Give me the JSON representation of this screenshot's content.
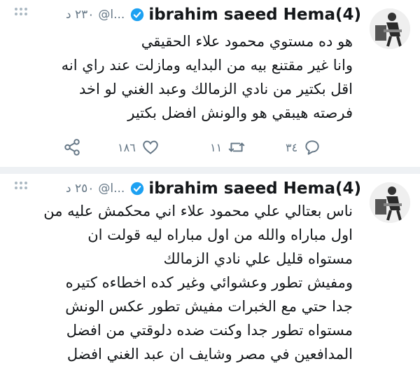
{
  "tweets": [
    {
      "user_name": "ibrahim saeed Hema(4)",
      "handle": "@ا...",
      "time": "٢٣٠ د",
      "lines": [
        "هو ده مستوي محمود علاء الحقيقي",
        "وانا غير مقتنع بيه من البدايه ومازلت عند راي انه",
        "اقل بكتير من نادي الزمالك وعبد الغني لو اخد",
        "فرصته هيبقي هو والونش افضل بكتير"
      ],
      "actions": {
        "replies": "٣٤",
        "retweets": "١١",
        "likes": "١٨٦"
      }
    },
    {
      "user_name": "ibrahim saeed Hema(4)",
      "handle": "@ا...",
      "time": "٢٥٠ د",
      "lines": [
        "ناس بعتالي علي محمود علاء اني محكمش عليه من",
        "اول مباراه والله من اول مباراه ليه قولت ان",
        "مستواه قليل علي نادي الزمالك",
        "ومفيش تطور وعشوائي وغير كده اخطاءه كتيره",
        "جدا حتي مع الخبرات مفيش تطور عكس الونش",
        "مستواه تطور جدا وكنت ضده دلوقتي من افضل",
        "المدافعين في مصر وشايف ان عبد الغني افضل"
      ]
    }
  ],
  "colors": {
    "verified": "#1da1f2",
    "secondary_text": "#657786",
    "text": "#14171a"
  },
  "icons": [
    "avatar",
    "verified-icon",
    "more-icon",
    "reply-icon",
    "retweet-icon",
    "like-icon",
    "share-icon"
  ]
}
